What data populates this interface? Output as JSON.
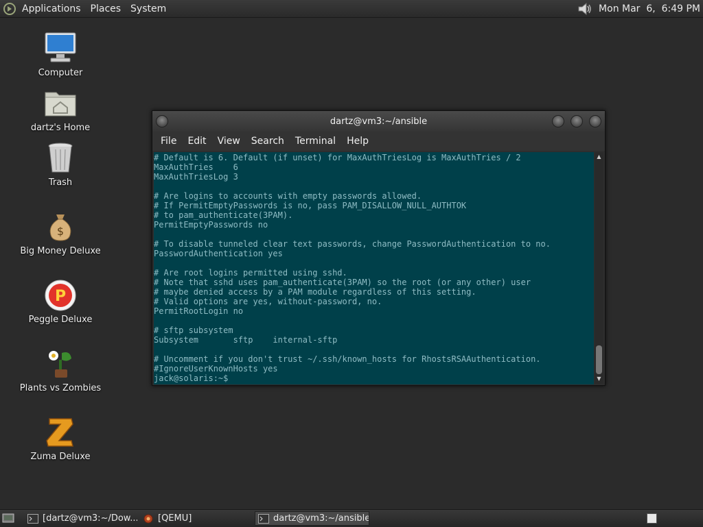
{
  "top_panel": {
    "menus": [
      "Applications",
      "Places",
      "System"
    ],
    "clock": "Mon Mar  6,  6:49 PM",
    "icons": {
      "logo": "gnome-foot-icon",
      "volume": "speaker-icon"
    }
  },
  "desktop": {
    "icons": [
      {
        "label": "Computer",
        "icon": "computer-icon"
      },
      {
        "label": "dartz's Home",
        "icon": "home-folder-icon"
      },
      {
        "label": "Trash",
        "icon": "trash-icon"
      },
      {
        "label": "Big Money Deluxe",
        "icon": "money-bag-icon"
      },
      {
        "label": "Peggle Deluxe",
        "icon": "peggle-icon"
      },
      {
        "label": "Plants vs Zombies",
        "icon": "plants-icon"
      },
      {
        "label": "Zuma Deluxe",
        "icon": "zuma-icon"
      }
    ]
  },
  "terminal": {
    "title": "dartz@vm3:~/ansible",
    "menu": [
      "File",
      "Edit",
      "View",
      "Search",
      "Terminal",
      "Help"
    ],
    "lines": [
      "# Default is 6. Default (if unset) for MaxAuthTriesLog is MaxAuthTries / 2",
      "MaxAuthTries    6",
      "MaxAuthTriesLog 3",
      "",
      "# Are logins to accounts with empty passwords allowed.",
      "# If PermitEmptyPasswords is no, pass PAM_DISALLOW_NULL_AUTHTOK",
      "# to pam_authenticate(3PAM).",
      "PermitEmptyPasswords no",
      "",
      "# To disable tunneled clear text passwords, change PasswordAuthentication to no.",
      "PasswordAuthentication yes",
      "",
      "# Are root logins permitted using sshd.",
      "# Note that sshd uses pam_authenticate(3PAM) so the root (or any other) user",
      "# maybe denied access by a PAM module regardless of this setting.",
      "# Valid options are yes, without-password, no.",
      "PermitRootLogin no",
      "",
      "# sftp subsystem",
      "Subsystem       sftp    internal-sftp",
      "",
      "# Uncomment if you don't trust ~/.ssh/known_hosts for RhostsRSAAuthentication.",
      "#IgnoreUserKnownHosts yes",
      "jack@solaris:~$ "
    ]
  },
  "taskbar": {
    "tasks": [
      {
        "label": "[dartz@vm3:~/Dow...",
        "icon": "terminal-icon"
      },
      {
        "label": "[QEMU]",
        "icon": "qemu-icon"
      },
      {
        "label": "dartz@vm3:~/ansible",
        "icon": "terminal-icon"
      }
    ]
  },
  "colors": {
    "terminal_bg": "#00404a",
    "terminal_fg": "#8fbcc4"
  }
}
